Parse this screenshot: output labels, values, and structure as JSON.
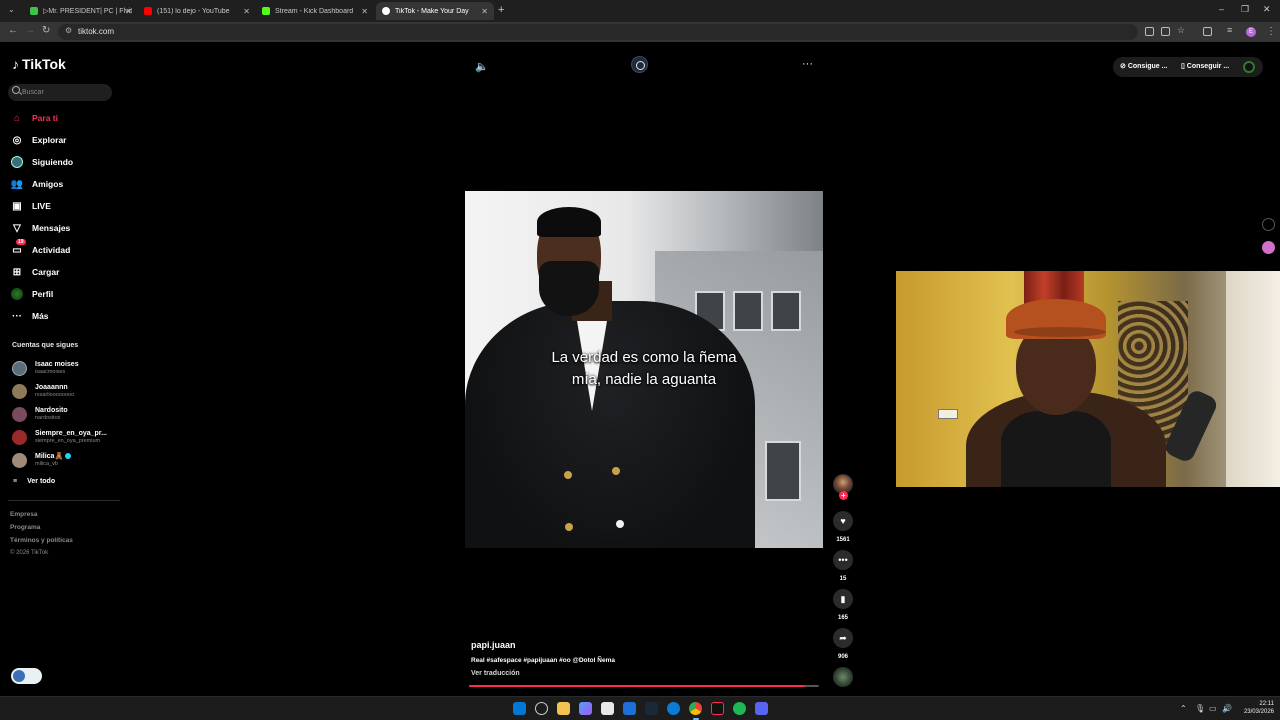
{
  "browser": {
    "tabs": [
      {
        "title": "▷Mr. PRESIDENT| PC | FlviGam",
        "favicon_color": "#3ec34a",
        "active": false
      },
      {
        "title": "(151) lo dejo - YouTube",
        "favicon_color": "#ff0000",
        "active": false
      },
      {
        "title": "Stream - Kick Dashboard",
        "favicon_color": "#53fc18",
        "active": false
      },
      {
        "title": "TikTok - Make Your Day",
        "favicon_color": "#ffffff",
        "active": true
      }
    ],
    "new_tab_label": "+",
    "url": "tiktok.com",
    "profile_initial": "E"
  },
  "tiktok": {
    "logo_text": "TikTok",
    "search_placeholder": "Buscar",
    "nav": [
      {
        "label": "Para ti",
        "icon": "home-icon",
        "active": true
      },
      {
        "label": "Explorar",
        "icon": "compass-icon",
        "active": false
      },
      {
        "label": "Siguiendo",
        "icon": "following-icon",
        "active": false
      },
      {
        "label": "Amigos",
        "icon": "friends-icon",
        "active": false
      },
      {
        "label": "LIVE",
        "icon": "live-icon",
        "active": false
      },
      {
        "label": "Mensajes",
        "icon": "messages-icon",
        "active": false
      },
      {
        "label": "Actividad",
        "icon": "activity-icon",
        "active": false,
        "badge": "19"
      },
      {
        "label": "Cargar",
        "icon": "upload-icon",
        "active": false
      },
      {
        "label": "Perfil",
        "icon": "profile-icon",
        "active": false
      },
      {
        "label": "Más",
        "icon": "more-icon",
        "active": false
      }
    ],
    "following_title": "Cuentas que sigues",
    "following": [
      {
        "name": "Isaac moises",
        "username": "isaacmoises",
        "avatar_color": "#5a6e7a"
      },
      {
        "name": "Joaaannn",
        "username": "rxsarlioooooooo",
        "avatar_color": "#8c7a5a"
      },
      {
        "name": "Nardosito",
        "username": "nardositos",
        "avatar_color": "#7a4a5e"
      },
      {
        "name": "Siempre_en_oya_pr...",
        "username": "siempre_en_oya_premium",
        "avatar_color": "#9a2a2a"
      },
      {
        "name": "Milica🧸",
        "username": "milica_vb",
        "avatar_color": "#a08a7a",
        "verified": true
      }
    ],
    "see_all": "Ver todo",
    "footer": [
      "Empresa",
      "Programa",
      "Términos y políticas"
    ],
    "copyright": "© 2026 TikTok",
    "top_pills": {
      "coins": "Consigue ...",
      "app": "Conseguir ..."
    },
    "video": {
      "caption_line1": "La verdad es como la ñema",
      "caption_line2": "mía, nadie la aguanta",
      "author": "papi.juaan",
      "description": "Real #safespace #papijuaan #oo @Dotol Ñema",
      "translate": "Ver traducción",
      "progress": 0.96,
      "likes": "1561",
      "comments": "15",
      "saves": "165",
      "shares": "906"
    }
  },
  "taskbar": {
    "time": "22:11",
    "date": "23/03/2026",
    "accent": "#0078d4"
  }
}
